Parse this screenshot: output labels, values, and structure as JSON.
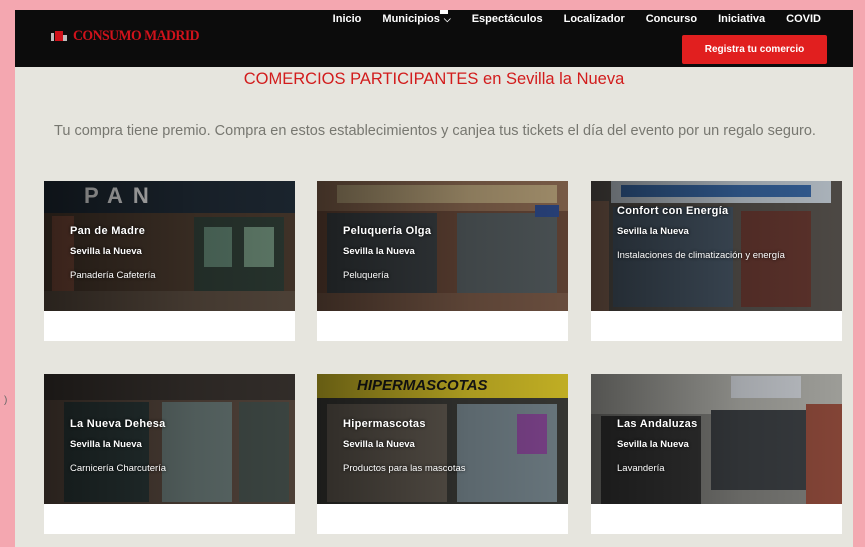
{
  "header": {
    "logo_text": "CONSUMO MADRID",
    "nav": [
      "Inicio",
      "Municipios",
      "Espectáculos",
      "Localizador",
      "Concurso",
      "Iniciativa",
      "COVID"
    ],
    "nav_caret": "⌵",
    "cta_label": "Registra tu comercio"
  },
  "main": {
    "title": "COMERCIOS PARTICIPANTES en Sevilla la Nueva",
    "subtitle": "Tu compra tiene premio. Compra en estos establecimientos y canjea tus tickets el día del evento por un regalo seguro."
  },
  "shops": [
    {
      "name": "Pan de Madre",
      "town": "Sevilla la Nueva",
      "category": "Panadería Cafetería",
      "sign": "PAN"
    },
    {
      "name": "Peluquería Olga",
      "town": "Sevilla la Nueva",
      "category": "Peluquería",
      "sign": ""
    },
    {
      "name": "Confort con Energía",
      "town": "Sevilla la Nueva",
      "category": "Instalaciones de climatización y energía",
      "sign": ""
    },
    {
      "name": "La Nueva Dehesa",
      "town": "Sevilla la Nueva",
      "category": "Carnicería Charcutería",
      "sign": ""
    },
    {
      "name": "Hipermascotas",
      "town": "Sevilla la Nueva",
      "category": "Productos para las mascotas",
      "sign": "HIPERMASCOTAS"
    },
    {
      "name": "Las Andaluzas",
      "town": "Sevilla la Nueva",
      "category": "Lavandería",
      "sign": ""
    }
  ],
  "colors": {
    "accent": "#e11f1f",
    "title": "#d21c1c",
    "page_bg": "#e6e5de",
    "outer_bg": "#f4a7b0",
    "topbar": "#0c0c0c"
  },
  "left_mark": ")"
}
